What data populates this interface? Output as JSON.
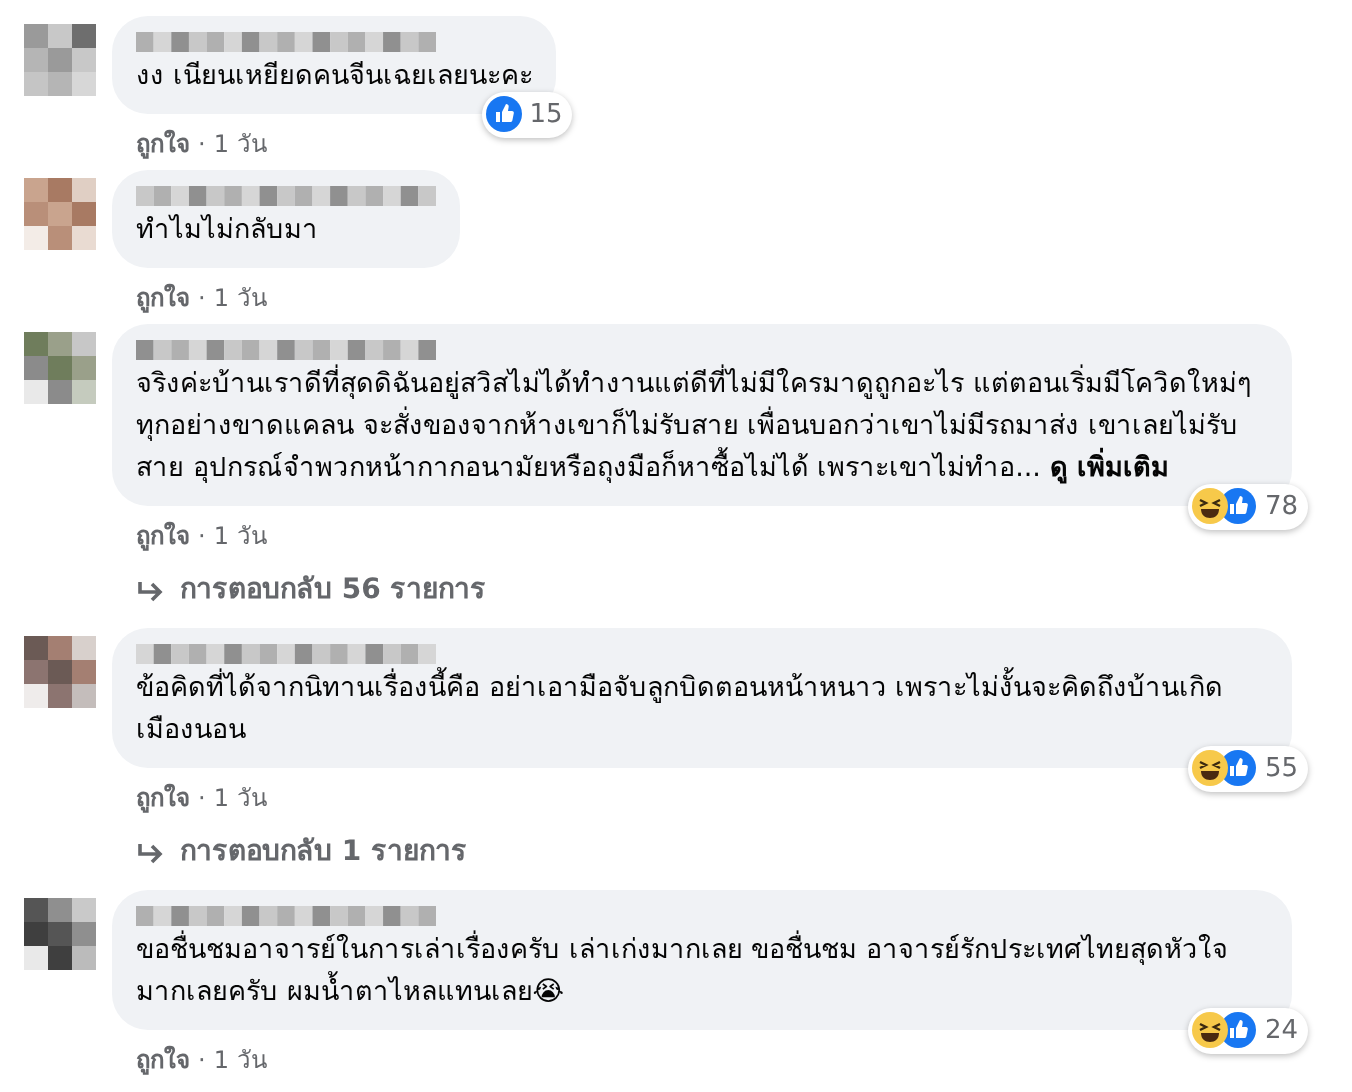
{
  "comments": [
    {
      "text": "งง เนียนเหยียดคนจีนเฉยเลยนะคะ",
      "wide": false,
      "reactions": {
        "like": true
      },
      "reaction_count": "15",
      "like_label": "ถูกใจ",
      "separator": "·",
      "time": "1 วัน"
    },
    {
      "text": "ทำไมไม่กลับมา",
      "wide": false,
      "like_label": "ถูกใจ",
      "separator": "·",
      "time": "1 วัน"
    },
    {
      "text": "จริงค่ะบ้านเราดีที่สุดดิฉันอยู่สวิสไม่ได้ทำงานแต่ดีที่ไม่มีใครมาดูถูกอะไร แต่ตอนเริ่มมีโควิดใหม่ๆทุกอย่างขาดแคลน จะสั่งของจากห้างเขาก็ไม่รับสาย เพื่อนบอกว่าเขาไม่มีรถมาส่ง เขาเลยไม่รับสาย อุปกรณ์จำพวกหน้ากากอนามัยหรือถุงมือก็หาซื้อไม่ได้ เพราะเขาไม่ทำอ... **ดู เพิ่มเติม**",
      "wide": true,
      "reactions": {
        "haha": true,
        "like": true
      },
      "reaction_count": "78",
      "like_label": "ถูกใจ",
      "separator": "·",
      "time": "1 วัน",
      "replies": "การตอบกลับ 56 รายการ"
    },
    {
      "text": "ข้อคิดที่ได้จากนิทานเรื่องนี้คือ อย่าเอามือจับลูกบิดตอนหน้าหนาว เพราะไม่งั้นจะคิดถึงบ้านเกิดเมืองนอน",
      "wide": true,
      "reactions": {
        "haha": true,
        "like": true
      },
      "reaction_count": "55",
      "like_label": "ถูกใจ",
      "separator": "·",
      "time": "1 วัน",
      "replies": "การตอบกลับ 1 รายการ"
    },
    {
      "text": "ขอชื่นชมอาจารย์ในการเล่าเรื่องครับ เล่าเก่งมากเลย ขอชื่นชม อาจารย์รักประเทศไทยสุดหัวใจมากเลยครับ ผมน้ำตาไหลแทนเลย😭",
      "wide": true,
      "reactions": {
        "haha": true,
        "like": true
      },
      "reaction_count": "24",
      "like_label": "ถูกใจ",
      "separator": "·",
      "time": "1 วัน"
    }
  ]
}
